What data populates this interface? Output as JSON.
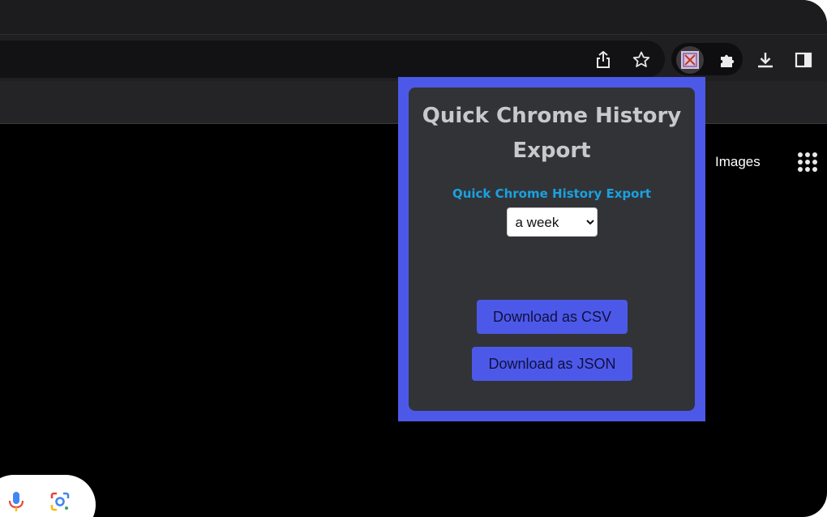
{
  "browser": {
    "toolbar_icons": [
      "share-icon",
      "bookmark-star-icon",
      "extension-history-export-icon",
      "puzzle-extensions-icon",
      "download-icon",
      "side-panel-icon"
    ]
  },
  "page": {
    "images_link": "Images"
  },
  "popup": {
    "title": "Quick Chrome History Export",
    "subtitle": "Quick Chrome History Export",
    "range_select": {
      "selected": "a week"
    },
    "download_csv_label": "Download as CSV",
    "download_json_label": "Download as JSON"
  },
  "colors": {
    "popup_border": "#4c59e8",
    "popup_bg": "#323337",
    "subtitle": "#1aa1e0",
    "button_bg": "#4c59e8"
  }
}
